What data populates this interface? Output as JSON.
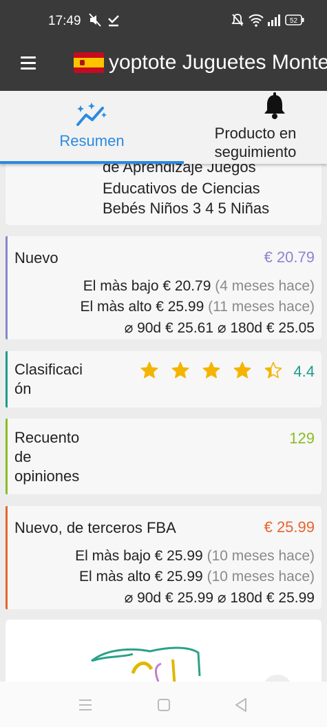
{
  "status_bar": {
    "time": "17:49",
    "battery": "52"
  },
  "app_bar": {
    "title": "yoptote Juguetes Monte"
  },
  "tabs": [
    {
      "label": "Resumen",
      "icon": "trending-chart-icon",
      "active": true
    },
    {
      "label": "Producto en seguimiento",
      "icon": "bell-icon",
      "active": false
    }
  ],
  "product_title_tail": [
    "de Aprendizaje Juegos",
    "Educativos de Ciencias",
    "Bebés Niños 3 4 5 Niñas"
  ],
  "new_price": {
    "label": "Nuevo",
    "value": "€ 20.79",
    "color": "#8a85d0",
    "lowest_label": "El màs bajo",
    "lowest_value": "€ 20.79",
    "lowest_ago": "(4 meses hace)",
    "highest_label": "El màs alto",
    "highest_value": "€ 25.99",
    "highest_ago": "(11 meses hace)",
    "avg90_label": "⌀ 90d",
    "avg90_value": "€ 25.61",
    "avg180_label": "⌀ 180d",
    "avg180_value": "€ 25.05"
  },
  "rating": {
    "label": "Clasificaci ón",
    "label_lines": [
      "Clasificaci",
      "ón"
    ],
    "value": "4.4",
    "stars": 4.4,
    "color": "#1a9b8b",
    "star_color": "#f4b400"
  },
  "reviews": {
    "label_lines": [
      "Recuento",
      "de",
      "opiniones"
    ],
    "value": "129",
    "color": "#8bbb22"
  },
  "fba": {
    "label": "Nuevo, de terceros FBA",
    "value": "€ 25.99",
    "color": "#e8632b",
    "lowest_label": "El màs bajo",
    "lowest_value": "€ 25.99",
    "lowest_ago": "(10 meses hace)",
    "highest_label": "El màs alto",
    "highest_value": "€ 25.99",
    "highest_ago": "(10 meses hace)",
    "avg90_label": "⌀ 90d",
    "avg90_value": "€ 25.99",
    "avg180_label": "⌀ 180d",
    "avg180_value": "€ 25.99"
  },
  "nav_bar": {
    "recents_icon": "recents-icon",
    "home_icon": "home-icon",
    "back_icon": "back-icon"
  }
}
